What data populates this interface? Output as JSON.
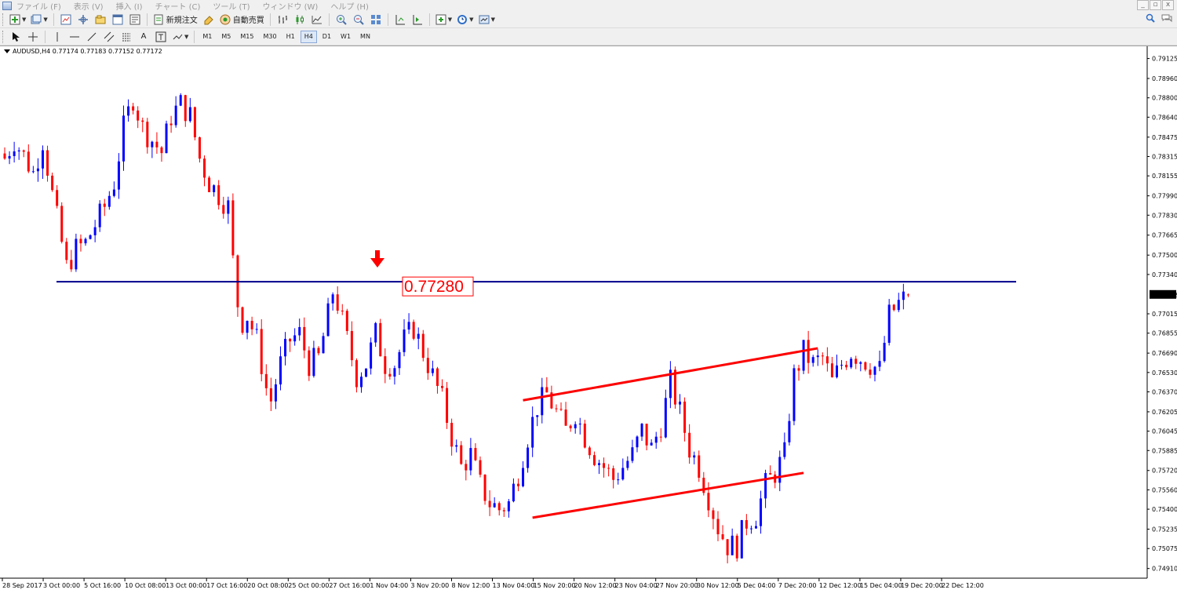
{
  "menu": {
    "items": [
      "ファイル (F)",
      "表示 (V)",
      "挿入 (I)",
      "チャート (C)",
      "ツール (T)",
      "ウィンドウ (W)",
      "ヘルプ (H)"
    ],
    "window_controls": [
      "_",
      "▫",
      "x"
    ]
  },
  "toolbar": {
    "new_order_label": "新規注文",
    "auto_trade_label": "自動売買",
    "timeframes": [
      "M1",
      "M5",
      "M15",
      "M30",
      "H1",
      "H4",
      "D1",
      "W1",
      "MN"
    ],
    "active_timeframe": "H4",
    "text_tool_label": "A"
  },
  "chart": {
    "title": "AUDUSD,H4  0.77174 0.77183 0.77152 0.77172",
    "current_price": "0.77172",
    "annotation_label": "0.77280",
    "price_axis": [
      "0.79125",
      "0.78960",
      "0.78800",
      "0.78640",
      "0.78475",
      "0.78315",
      "0.78155",
      "0.77990",
      "0.77830",
      "0.77665",
      "0.77500",
      "0.77340",
      "0.77015",
      "0.76855",
      "0.76690",
      "0.76530",
      "0.76370",
      "0.76205",
      "0.76045",
      "0.75885",
      "0.75720",
      "0.75560",
      "0.75400",
      "0.75235",
      "0.75075",
      "0.74910"
    ],
    "time_axis": [
      "28 Sep 2017",
      "3 Oct 00:00",
      "5 Oct 16:00",
      "10 Oct 08:00",
      "13 Oct 00:00",
      "17 Oct 16:00",
      "20 Oct 08:00",
      "25 Oct 00:00",
      "27 Oct 16:00",
      "1 Nov 04:00",
      "3 Nov 20:00",
      "8 Nov 12:00",
      "13 Nov 04:00",
      "15 Nov 20:00",
      "20 Nov 12:00",
      "23 Nov 04:00",
      "27 Nov 20:00",
      "30 Nov 12:00",
      "5 Dec 04:00",
      "7 Dec 20:00",
      "12 Dec 12:00",
      "15 Dec 04:00",
      "19 Dec 20:00",
      "22 Dec 12:00"
    ],
    "colors": {
      "bull": "#0000ff",
      "bear": "#ff0000",
      "level_line": "#00008b",
      "channel": "#ff0000",
      "annotation": "#ff0000"
    }
  },
  "chart_data": {
    "type": "candlestick",
    "symbol": "AUDUSD",
    "timeframe": "H4",
    "ohlc_last": {
      "open": 0.77174,
      "high": 0.77183,
      "low": 0.77152,
      "close": 0.77172
    },
    "ylim": [
      0.7483,
      0.792
    ],
    "close_path": [
      [
        0,
        0.783
      ],
      [
        2,
        0.7845
      ],
      [
        4,
        0.7832
      ],
      [
        6,
        0.7818
      ],
      [
        8,
        0.7845
      ],
      [
        10,
        0.78
      ],
      [
        12,
        0.776
      ],
      [
        13,
        0.774
      ],
      [
        15,
        0.7755
      ],
      [
        17,
        0.776
      ],
      [
        19,
        0.7775
      ],
      [
        21,
        0.779
      ],
      [
        23,
        0.781
      ],
      [
        25,
        0.7855
      ],
      [
        27,
        0.788
      ],
      [
        29,
        0.7855
      ],
      [
        31,
        0.7845
      ],
      [
        33,
        0.7835
      ],
      [
        35,
        0.7865
      ],
      [
        37,
        0.7875
      ],
      [
        39,
        0.7865
      ],
      [
        41,
        0.783
      ],
      [
        43,
        0.781
      ],
      [
        45,
        0.78
      ],
      [
        47,
        0.779
      ],
      [
        48,
        0.7745
      ],
      [
        49,
        0.771
      ],
      [
        50,
        0.7695
      ],
      [
        51,
        0.77
      ],
      [
        53,
        0.768
      ],
      [
        55,
        0.764
      ],
      [
        56,
        0.763
      ],
      [
        58,
        0.766
      ],
      [
        60,
        0.768
      ],
      [
        62,
        0.7685
      ],
      [
        64,
        0.766
      ],
      [
        66,
        0.7665
      ],
      [
        68,
        0.77
      ],
      [
        69,
        0.772
      ],
      [
        70,
        0.771
      ],
      [
        72,
        0.768
      ],
      [
        74,
        0.765
      ],
      [
        76,
        0.766
      ],
      [
        78,
        0.7685
      ],
      [
        80,
        0.766
      ],
      [
        82,
        0.766
      ],
      [
        84,
        0.768
      ],
      [
        86,
        0.769
      ],
      [
        88,
        0.767
      ],
      [
        90,
        0.765
      ],
      [
        92,
        0.763
      ],
      [
        94,
        0.76
      ],
      [
        96,
        0.7575
      ],
      [
        98,
        0.7585
      ],
      [
        100,
        0.756
      ],
      [
        102,
        0.7545
      ],
      [
        104,
        0.754
      ],
      [
        106,
        0.7545
      ],
      [
        108,
        0.757
      ],
      [
        110,
        0.76
      ],
      [
        112,
        0.7625
      ],
      [
        114,
        0.7635
      ],
      [
        116,
        0.762
      ],
      [
        118,
        0.7605
      ],
      [
        120,
        0.762
      ],
      [
        122,
        0.76
      ],
      [
        124,
        0.7585
      ],
      [
        126,
        0.7575
      ],
      [
        128,
        0.7565
      ],
      [
        130,
        0.7575
      ],
      [
        132,
        0.7585
      ],
      [
        134,
        0.7605
      ],
      [
        136,
        0.759
      ],
      [
        138,
        0.761
      ],
      [
        140,
        0.7645
      ],
      [
        142,
        0.762
      ],
      [
        144,
        0.759
      ],
      [
        146,
        0.7575
      ],
      [
        148,
        0.755
      ],
      [
        150,
        0.7525
      ],
      [
        152,
        0.751
      ],
      [
        154,
        0.751
      ],
      [
        156,
        0.753
      ],
      [
        158,
        0.7535
      ],
      [
        160,
        0.756
      ],
      [
        162,
        0.757
      ],
      [
        164,
        0.7585
      ],
      [
        165,
        0.762
      ],
      [
        166,
        0.765
      ],
      [
        168,
        0.767
      ],
      [
        170,
        0.766
      ],
      [
        172,
        0.7665
      ],
      [
        174,
        0.7645
      ],
      [
        176,
        0.766
      ],
      [
        178,
        0.767
      ],
      [
        180,
        0.7665
      ],
      [
        182,
        0.766
      ],
      [
        184,
        0.7655
      ],
      [
        186,
        0.77
      ],
      [
        188,
        0.771
      ],
      [
        190,
        0.7717
      ]
    ],
    "horizontal_levels": [
      {
        "price": 0.7728,
        "label": "0.77280"
      }
    ],
    "trendlines": [
      {
        "name": "channel-upper",
        "from": [
          109,
          0.763
        ],
        "to": [
          171,
          0.7673
        ]
      },
      {
        "name": "channel-lower",
        "from": [
          111,
          0.7533
        ],
        "to": [
          168,
          0.757
        ]
      }
    ]
  }
}
